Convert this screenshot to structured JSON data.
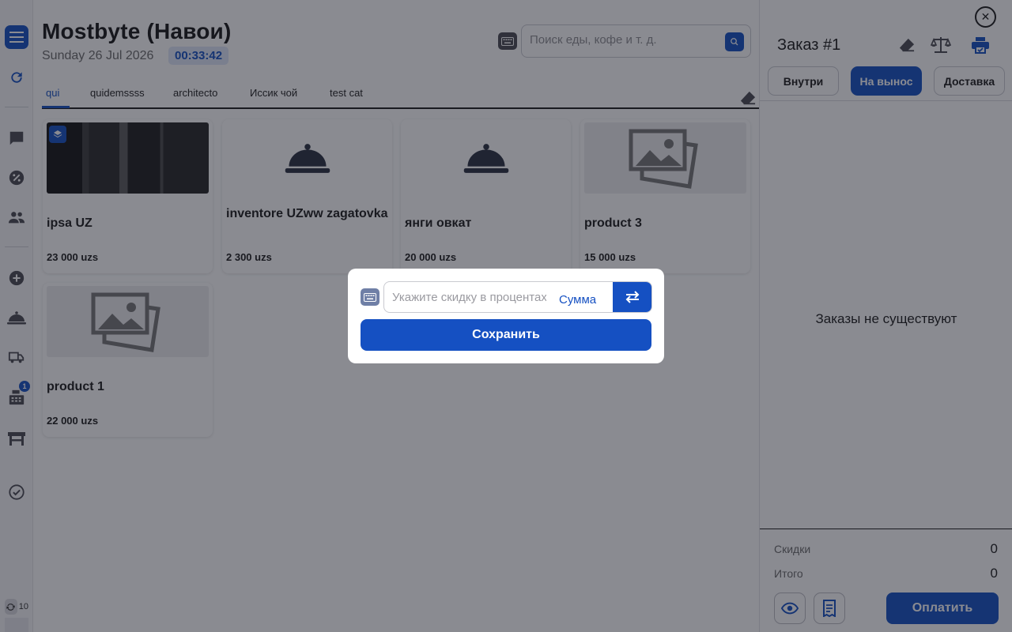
{
  "header": {
    "title": "Mostbyte (Навои)",
    "date": "Sunday 26 Jul 2026",
    "time": "00:33:42",
    "search_placeholder": "Поиск еды, кофе и т. д."
  },
  "sidebar": {
    "icons": [
      "menu-icon",
      "refresh-icon",
      "chat-icon",
      "percent-icon",
      "users-icon",
      "add-circle-icon",
      "cloche-icon",
      "truck-icon",
      "cash-register-icon",
      "table-icon",
      "check-circle-icon"
    ],
    "cash_register_badge": "1",
    "sync_count": "10"
  },
  "tabs": [
    {
      "label": "qui",
      "active": true
    },
    {
      "label": "quidemssss",
      "active": false
    },
    {
      "label": "architecto",
      "active": false
    },
    {
      "label": "Иссик чой",
      "active": false
    },
    {
      "label": "test cat",
      "active": false
    }
  ],
  "products": [
    {
      "name": "ipsa UZ",
      "price": "23 000 uzs",
      "image": "photo"
    },
    {
      "name": "inventore UZww zagatovka",
      "price": "2 300 uzs",
      "image": "cloche"
    },
    {
      "name": "янги овкат",
      "price": "20 000 uzs",
      "image": "cloche"
    },
    {
      "name": "product 3",
      "price": "15 000 uzs",
      "image": "placeholder"
    },
    {
      "name": "product 1",
      "price": "22 000 uzs",
      "image": "placeholder"
    }
  ],
  "order_panel": {
    "title": "Заказ #1",
    "modes": [
      {
        "label": "Внутри",
        "active": false
      },
      {
        "label": "На вынос",
        "active": true
      },
      {
        "label": "Доставка",
        "active": false
      }
    ],
    "empty_text": "Заказы не существуют",
    "discount_label": "Скидки",
    "discount_value": "0",
    "total_label": "Итого",
    "total_value": "0",
    "pay_label": "Оплатить"
  },
  "discount_modal": {
    "placeholder": "Укажите скидку в процентах",
    "mode_label": "Сумма",
    "save_label": "Сохранить"
  },
  "colors": {
    "accent": "#1550c2",
    "overlay": "#16182480"
  }
}
